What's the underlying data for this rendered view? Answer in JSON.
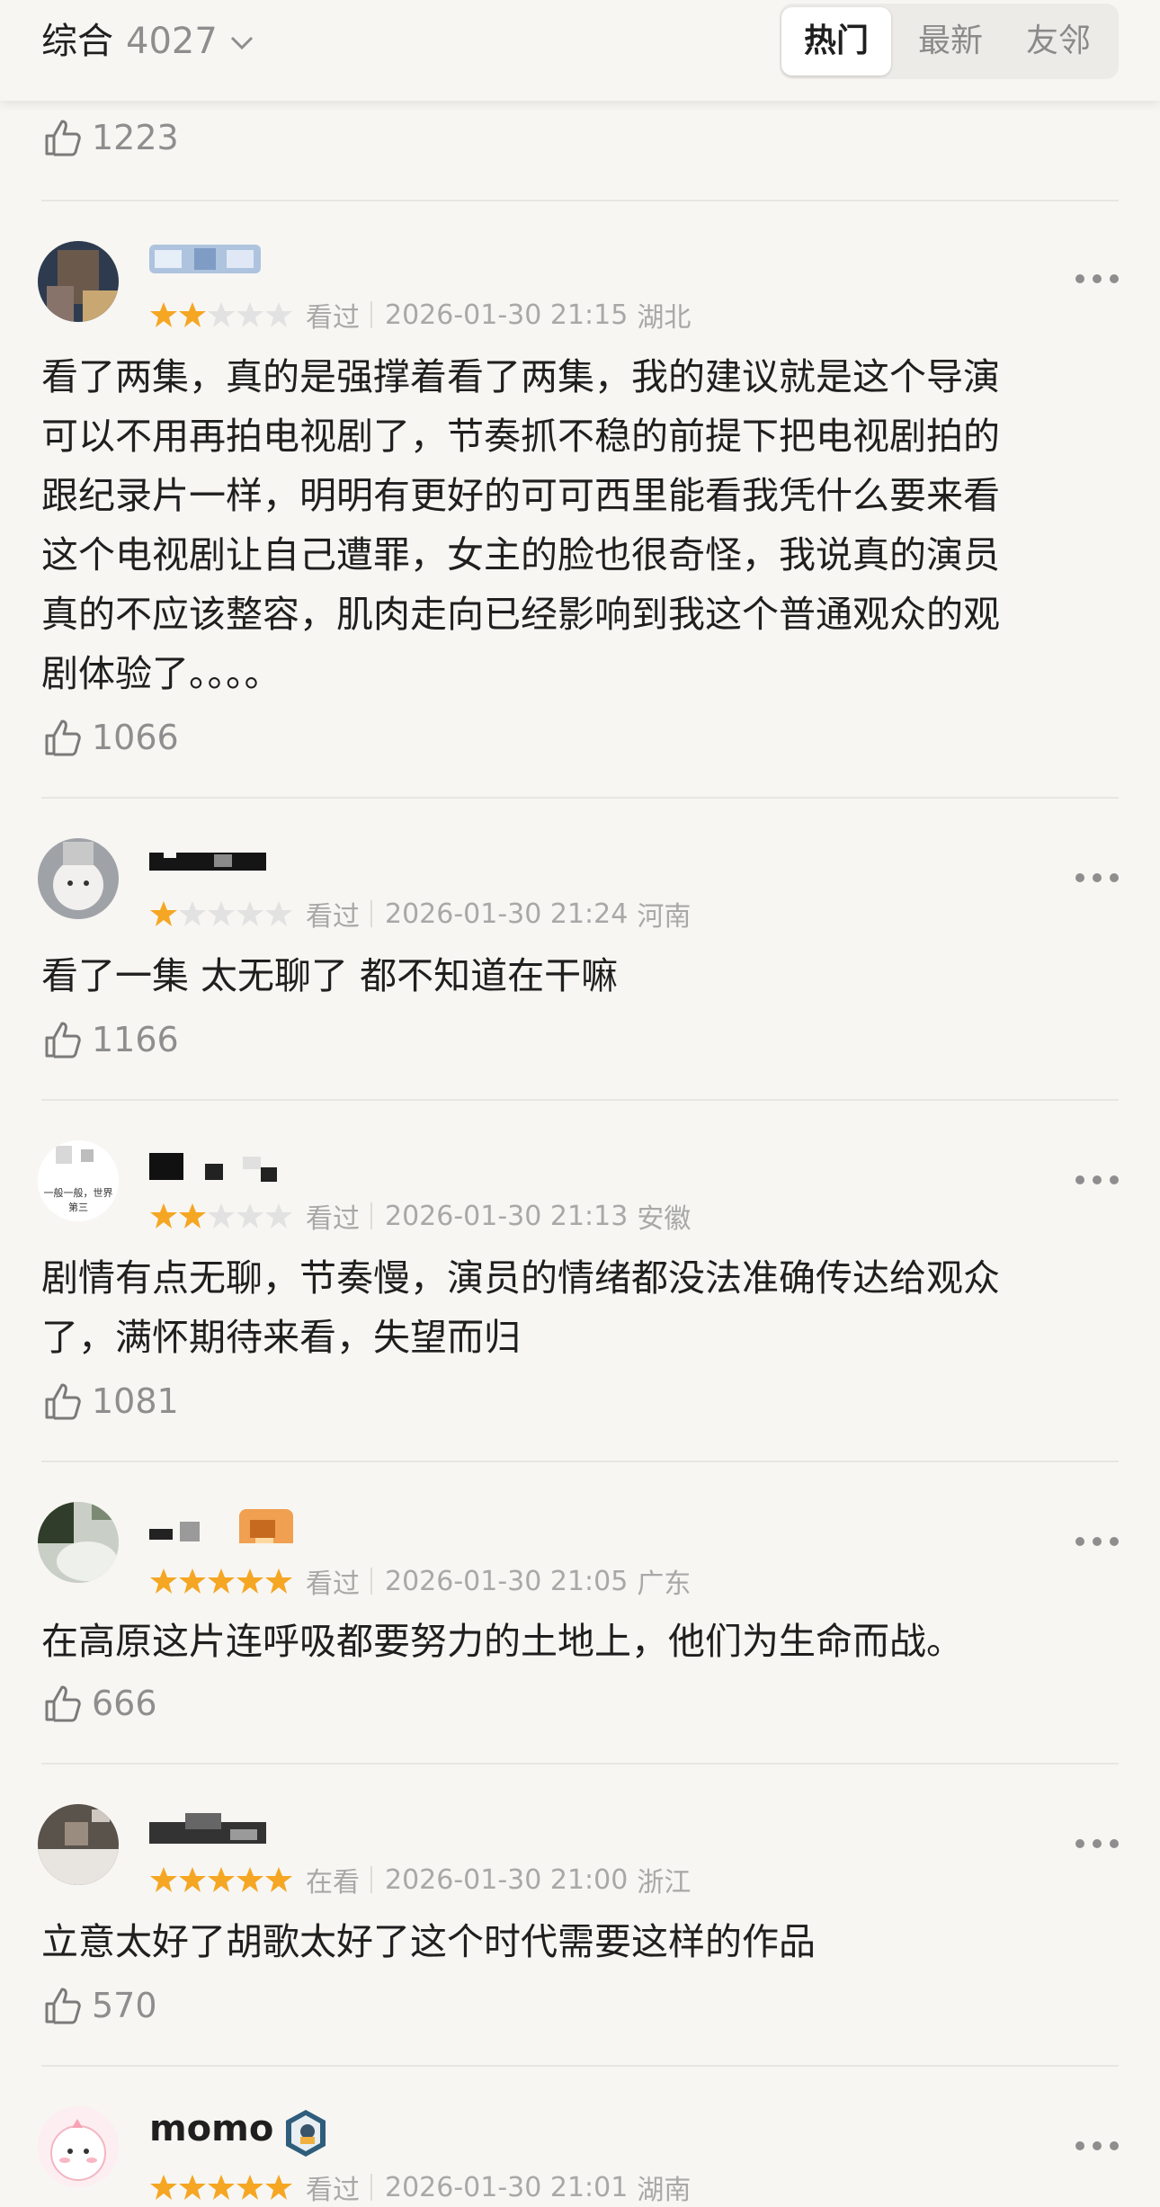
{
  "header": {
    "sort_label": "综合",
    "count": "4027",
    "tabs": [
      {
        "label": "热门",
        "active": true
      },
      {
        "label": "最新",
        "active": false
      },
      {
        "label": "友邻",
        "active": false
      }
    ]
  },
  "top_like": {
    "count": "1223"
  },
  "reviews": [
    {
      "name": "",
      "rating": 2,
      "status": "看过",
      "time": "2026-01-30 21:15",
      "location": "湖北",
      "text": "看了两集，真的是强撑着看了两集，我的建议就是这个导演\n可以不用再拍电视剧了，节奏抓不稳的前提下把电视剧拍的\n跟纪录片一样，明明有更好的可可西里能看我凭什么要来看\n这个电视剧让自己遭罪，女主的脸也很奇怪，我说真的演员\n真的不应该整容，肌肉走向已经影响到我这个普通观众的观\n剧体验了。。。。",
      "likes": "1066"
    },
    {
      "name": "",
      "rating": 1,
      "status": "看过",
      "time": "2026-01-30 21:24",
      "location": "河南",
      "text": "看了一集 太无聊了 都不知道在干嘛",
      "likes": "1166",
      "avatar_caption": ""
    },
    {
      "name": "",
      "rating": 2,
      "status": "看过",
      "time": "2026-01-30 21:13",
      "location": "安徽",
      "text": "剧情有点无聊，节奏慢，演员的情绪都没法准确传达给观众\n了，满怀期待来看，失望而归",
      "likes": "1081",
      "avatar_caption": "一般一般，世界\n第三"
    },
    {
      "name": "",
      "rating": 5,
      "status": "看过",
      "time": "2026-01-30 21:05",
      "location": "广东",
      "text": "在高原这片连呼吸都要努力的土地上，他们为生命而战。",
      "likes": "666"
    },
    {
      "name": "",
      "rating": 5,
      "status": "在看",
      "time": "2026-01-30 21:00",
      "location": "浙江",
      "text": "立意太好了胡歌太好了这个时代需要这样的作品",
      "likes": "570"
    },
    {
      "name": "momo",
      "rating": 5,
      "status": "看过",
      "time": "2026-01-30 21:01",
      "location": "湖南",
      "text": "",
      "likes": ""
    }
  ],
  "colors": {
    "star_on": "#f5a623",
    "star_off": "#e2e2e2",
    "meta": "#a8a8a8"
  }
}
